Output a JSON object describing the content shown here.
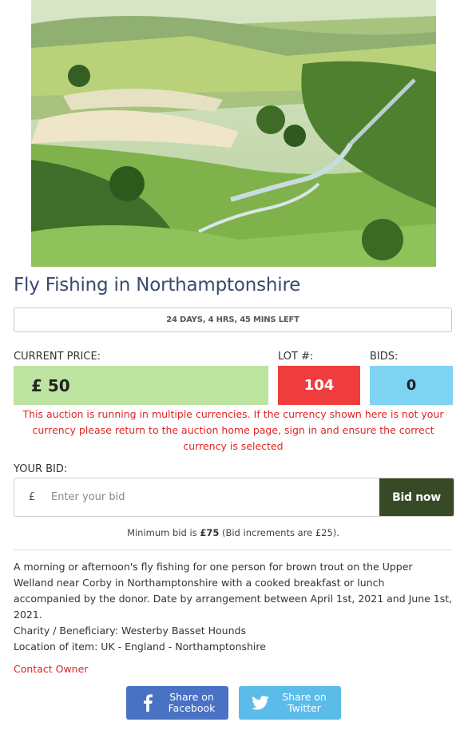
{
  "item": {
    "title": "Fly Fishing in Northamptonshire",
    "time_left": "24 DAYS, 4 HRS, 45 MINS LEFT",
    "current_price_label": "CURRENT PRICE:",
    "current_price": "£ 50",
    "lot_label": "LOT #:",
    "lot_number": "104",
    "bids_label": "BIDS:",
    "bids_count": "0",
    "currency_warning": "This auction is running in multiple currencies. If the currency shown here is not your currency please return to the auction home page, sign in and ensure the correct currency is selected"
  },
  "bid": {
    "label": "YOUR BID:",
    "currency_symbol": "£",
    "placeholder": "Enter your bid",
    "button": "Bid now",
    "min_prefix": "Minimum bid is ",
    "min_amount": "£75",
    "increment_text": " (Bid increments are £25)."
  },
  "description": "A morning or afternoon's fly fishing for one person for brown trout on the Upper Welland near Corby in Northamptonshire with a cooked breakfast or lunch accompanied by the donor. Date by arrangement between April 1st, 2021 and June 1st, 2021.",
  "charity": "Charity / Beneficiary: Westerby Basset Hounds",
  "location": "Location of item: UK - England - Northamptonshire",
  "contact": "Contact Owner",
  "share": {
    "facebook_line1": "Share on",
    "facebook_line2": "Facebook",
    "twitter_line1": "Share on",
    "twitter_line2": "Twitter"
  },
  "icons": [
    "facebook-icon",
    "twitter-icon"
  ],
  "colors": {
    "title": "#3b4a6b",
    "price_bg": "#bde4a0",
    "lot_bg": "#ef3d3d",
    "bids_bg": "#7fd3f2",
    "warning": "#e02424",
    "bid_button": "#354a25",
    "facebook": "#4a72c4",
    "twitter": "#5bbcea"
  }
}
